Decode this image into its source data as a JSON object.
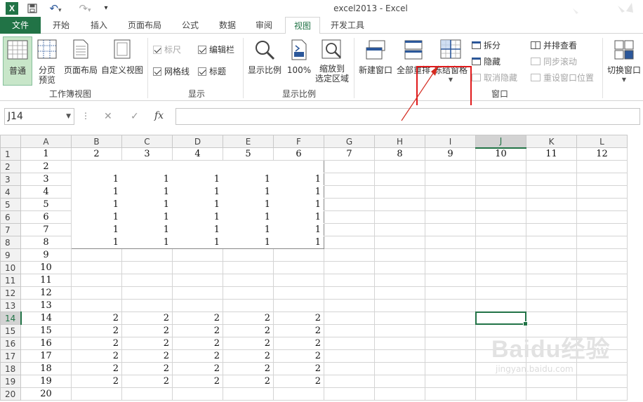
{
  "window": {
    "title": "excel2013 - Excel"
  },
  "qat": {
    "save_icon": "save-icon",
    "undo_icon": "undo-icon",
    "redo_icon": "redo-icon",
    "customize": "▾"
  },
  "tabs": [
    "文件",
    "开始",
    "插入",
    "页面布局",
    "公式",
    "数据",
    "审阅",
    "视图",
    "开发工具"
  ],
  "active_tab": "视图",
  "ribbon": {
    "workbook_views": {
      "label": "工作簿视图",
      "normal": "普通",
      "page_break_1": "分页",
      "page_break_2": "预览",
      "page_layout": "页面布局",
      "custom_views": "自定义视图"
    },
    "show": {
      "label": "显示",
      "ruler": "标尺",
      "formula_bar": "编辑栏",
      "gridlines": "网格线",
      "headings": "标题"
    },
    "zoom": {
      "label": "显示比例",
      "zoom": "显示比例",
      "zoom100": "100%",
      "zoom_sel_1": "缩放到",
      "zoom_sel_2": "选定区域"
    },
    "window": {
      "label": "窗口",
      "new_window": "新建窗口",
      "arrange_all": "全部重排",
      "freeze_panes": "冻结窗格",
      "split": "拆分",
      "hide": "隐藏",
      "unhide": "取消隐藏",
      "side_by_side": "并排查看",
      "sync_scroll": "同步滚动",
      "reset_pos": "重设窗口位置",
      "switch": "切换窗口"
    }
  },
  "formula_bar": {
    "name_box": "J14",
    "cancel": "✕",
    "enter": "✓",
    "fx": "fx",
    "value": ""
  },
  "sheet": {
    "columns": [
      "A",
      "B",
      "C",
      "D",
      "E",
      "F",
      "G",
      "H",
      "I",
      "J",
      "K",
      "L"
    ],
    "selected_column": "J",
    "selected_row": "14",
    "rows": [
      {
        "r": "1",
        "cells": [
          "1",
          "2",
          "3",
          "4",
          "5",
          "6",
          "7",
          "8",
          "9",
          "10",
          "11",
          "12"
        ]
      },
      {
        "r": "2",
        "cells": [
          "2",
          "",
          "",
          "",
          "",
          "",
          "",
          "",
          "",
          "",
          "",
          ""
        ]
      },
      {
        "r": "3",
        "cells": [
          "3",
          "1",
          "1",
          "1",
          "1",
          "1",
          "",
          "",
          "",
          "",
          "",
          ""
        ]
      },
      {
        "r": "4",
        "cells": [
          "4",
          "1",
          "1",
          "1",
          "1",
          "1",
          "",
          "",
          "",
          "",
          "",
          ""
        ]
      },
      {
        "r": "5",
        "cells": [
          "5",
          "1",
          "1",
          "1",
          "1",
          "1",
          "",
          "",
          "",
          "",
          "",
          ""
        ]
      },
      {
        "r": "6",
        "cells": [
          "6",
          "1",
          "1",
          "1",
          "1",
          "1",
          "",
          "",
          "",
          "",
          "",
          ""
        ]
      },
      {
        "r": "7",
        "cells": [
          "7",
          "1",
          "1",
          "1",
          "1",
          "1",
          "",
          "",
          "",
          "",
          "",
          ""
        ]
      },
      {
        "r": "8",
        "cells": [
          "8",
          "1",
          "1",
          "1",
          "1",
          "1",
          "",
          "",
          "",
          "",
          "",
          ""
        ]
      },
      {
        "r": "9",
        "cells": [
          "9",
          "",
          "",
          "",
          "",
          "",
          "",
          "",
          "",
          "",
          "",
          ""
        ]
      },
      {
        "r": "10",
        "cells": [
          "10",
          "",
          "",
          "",
          "",
          "",
          "",
          "",
          "",
          "",
          "",
          ""
        ]
      },
      {
        "r": "11",
        "cells": [
          "11",
          "",
          "",
          "",
          "",
          "",
          "",
          "",
          "",
          "",
          "",
          ""
        ]
      },
      {
        "r": "12",
        "cells": [
          "12",
          "",
          "",
          "",
          "",
          "",
          "",
          "",
          "",
          "",
          "",
          ""
        ]
      },
      {
        "r": "13",
        "cells": [
          "13",
          "",
          "",
          "",
          "",
          "",
          "",
          "",
          "",
          "",
          "",
          ""
        ]
      },
      {
        "r": "14",
        "cells": [
          "14",
          "2",
          "2",
          "2",
          "2",
          "2",
          "",
          "",
          "",
          "",
          "",
          ""
        ]
      },
      {
        "r": "15",
        "cells": [
          "15",
          "2",
          "2",
          "2",
          "2",
          "2",
          "",
          "",
          "",
          "",
          "",
          ""
        ]
      },
      {
        "r": "16",
        "cells": [
          "16",
          "2",
          "2",
          "2",
          "2",
          "2",
          "",
          "",
          "",
          "",
          "",
          ""
        ]
      },
      {
        "r": "17",
        "cells": [
          "17",
          "2",
          "2",
          "2",
          "2",
          "2",
          "",
          "",
          "",
          "",
          "",
          ""
        ]
      },
      {
        "r": "18",
        "cells": [
          "18",
          "2",
          "2",
          "2",
          "2",
          "2",
          "",
          "",
          "",
          "",
          "",
          ""
        ]
      },
      {
        "r": "19",
        "cells": [
          "19",
          "2",
          "2",
          "2",
          "2",
          "2",
          "",
          "",
          "",
          "",
          "",
          ""
        ]
      },
      {
        "r": "20",
        "cells": [
          "20",
          "",
          "",
          "",
          "",
          "",
          "",
          "",
          "",
          "",
          "",
          ""
        ]
      }
    ]
  },
  "watermark": {
    "brand": "Baidu经验",
    "url": "jingyan.baidu.com"
  },
  "colors": {
    "accent": "#217346",
    "highlight": "#e0191b"
  }
}
